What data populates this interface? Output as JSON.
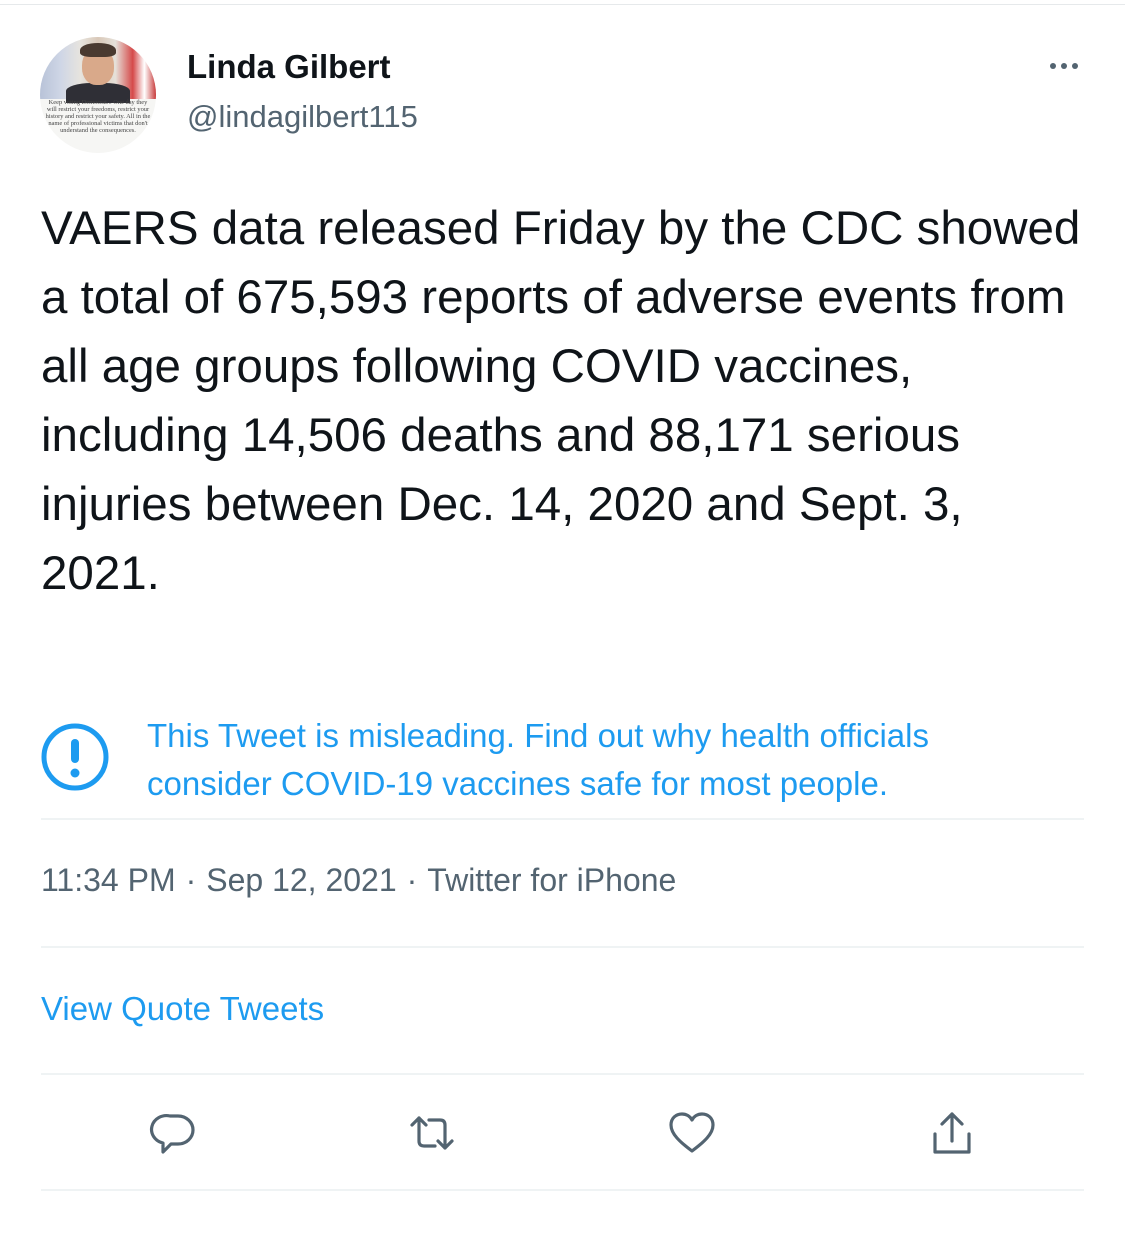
{
  "author": {
    "display_name": "Linda Gilbert",
    "handle": "@lindagilbert115",
    "avatar_caption": "Keep voting Democrat... One day they will restrict your freedoms, restrict your history and restrict your safety. All in the name of professional victims that don't understand the consequences."
  },
  "tweet": {
    "text": "VAERS data released Friday by the CDC showed a total of 675,593 reports of adverse events from all age groups following COVID vaccines, including 14,506 deaths and 88,171 serious injuries between Dec. 14, 2020 and Sept. 3, 2021."
  },
  "notice": {
    "text": "This Tweet is misleading. Find out why health officials consider COVID-19 vaccines safe for most people.",
    "icon": "exclamation-circle-icon"
  },
  "meta": {
    "time": "11:34 PM",
    "separator": "·",
    "date": "Sep 12, 2021",
    "source": "Twitter for iPhone"
  },
  "links": {
    "view_quotes": "View Quote Tweets"
  },
  "actions": [
    "reply-icon",
    "retweet-icon",
    "like-icon",
    "share-icon"
  ],
  "colors": {
    "link_blue": "#1d9bf0",
    "secondary_text": "#536471",
    "primary_text": "#0f1419",
    "divider": "#eff3f4"
  }
}
